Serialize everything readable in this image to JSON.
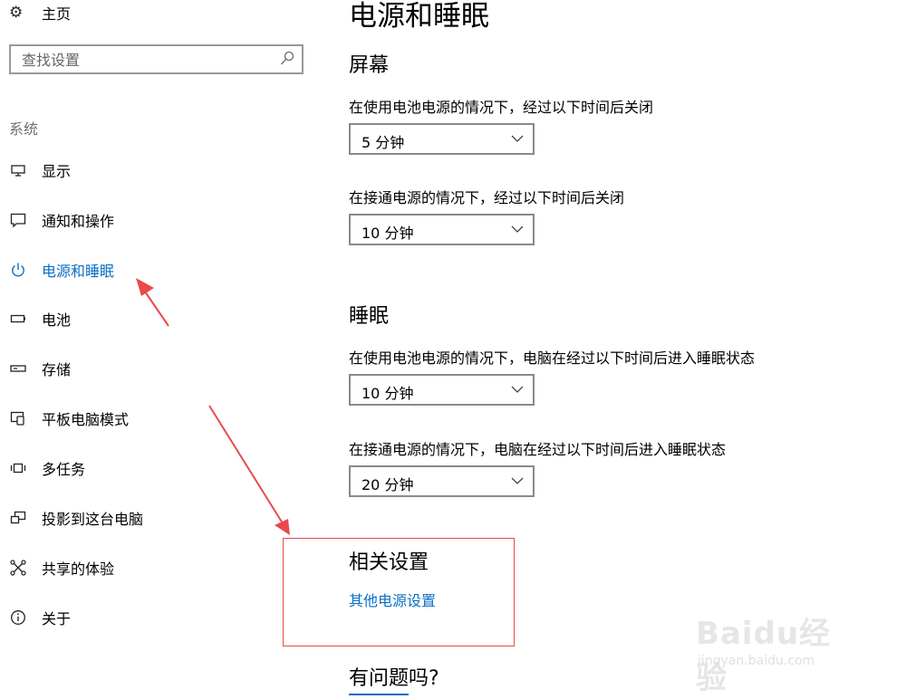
{
  "sidebar": {
    "home_label": "主页",
    "search_placeholder": "查找设置",
    "section": "系统",
    "items": [
      {
        "label": "显示",
        "icon": "monitor-icon"
      },
      {
        "label": "通知和操作",
        "icon": "notification-icon"
      },
      {
        "label": "电源和睡眠",
        "icon": "power-icon",
        "active": true
      },
      {
        "label": "电池",
        "icon": "battery-icon"
      },
      {
        "label": "存储",
        "icon": "storage-icon"
      },
      {
        "label": "平板电脑模式",
        "icon": "tablet-mode-icon"
      },
      {
        "label": "多任务",
        "icon": "multitask-icon"
      },
      {
        "label": "投影到这台电脑",
        "icon": "project-icon"
      },
      {
        "label": "共享的体验",
        "icon": "shared-experience-icon"
      },
      {
        "label": "关于",
        "icon": "info-icon"
      }
    ]
  },
  "main": {
    "title": "电源和睡眠",
    "screen": {
      "heading": "屏幕",
      "battery_label": "在使用电池电源的情况下，经过以下时间后关闭",
      "battery_value": "5 分钟",
      "plugged_label": "在接通电源的情况下，经过以下时间后关闭",
      "plugged_value": "10 分钟"
    },
    "sleep": {
      "heading": "睡眠",
      "battery_label": "在使用电池电源的情况下，电脑在经过以下时间后进入睡眠状态",
      "battery_value": "10 分钟",
      "plugged_label": "在接通电源的情况下，电脑在经过以下时间后进入睡眠状态",
      "plugged_value": "20 分钟"
    },
    "related": {
      "heading": "相关设置",
      "link": "其他电源设置"
    },
    "question": {
      "heading": "有问题吗?"
    }
  },
  "watermark": {
    "brand": "Baidu经验",
    "url": "jingyan.baidu.com"
  },
  "colors": {
    "accent": "#0a6fc2",
    "annotation": "#e84a4a"
  }
}
